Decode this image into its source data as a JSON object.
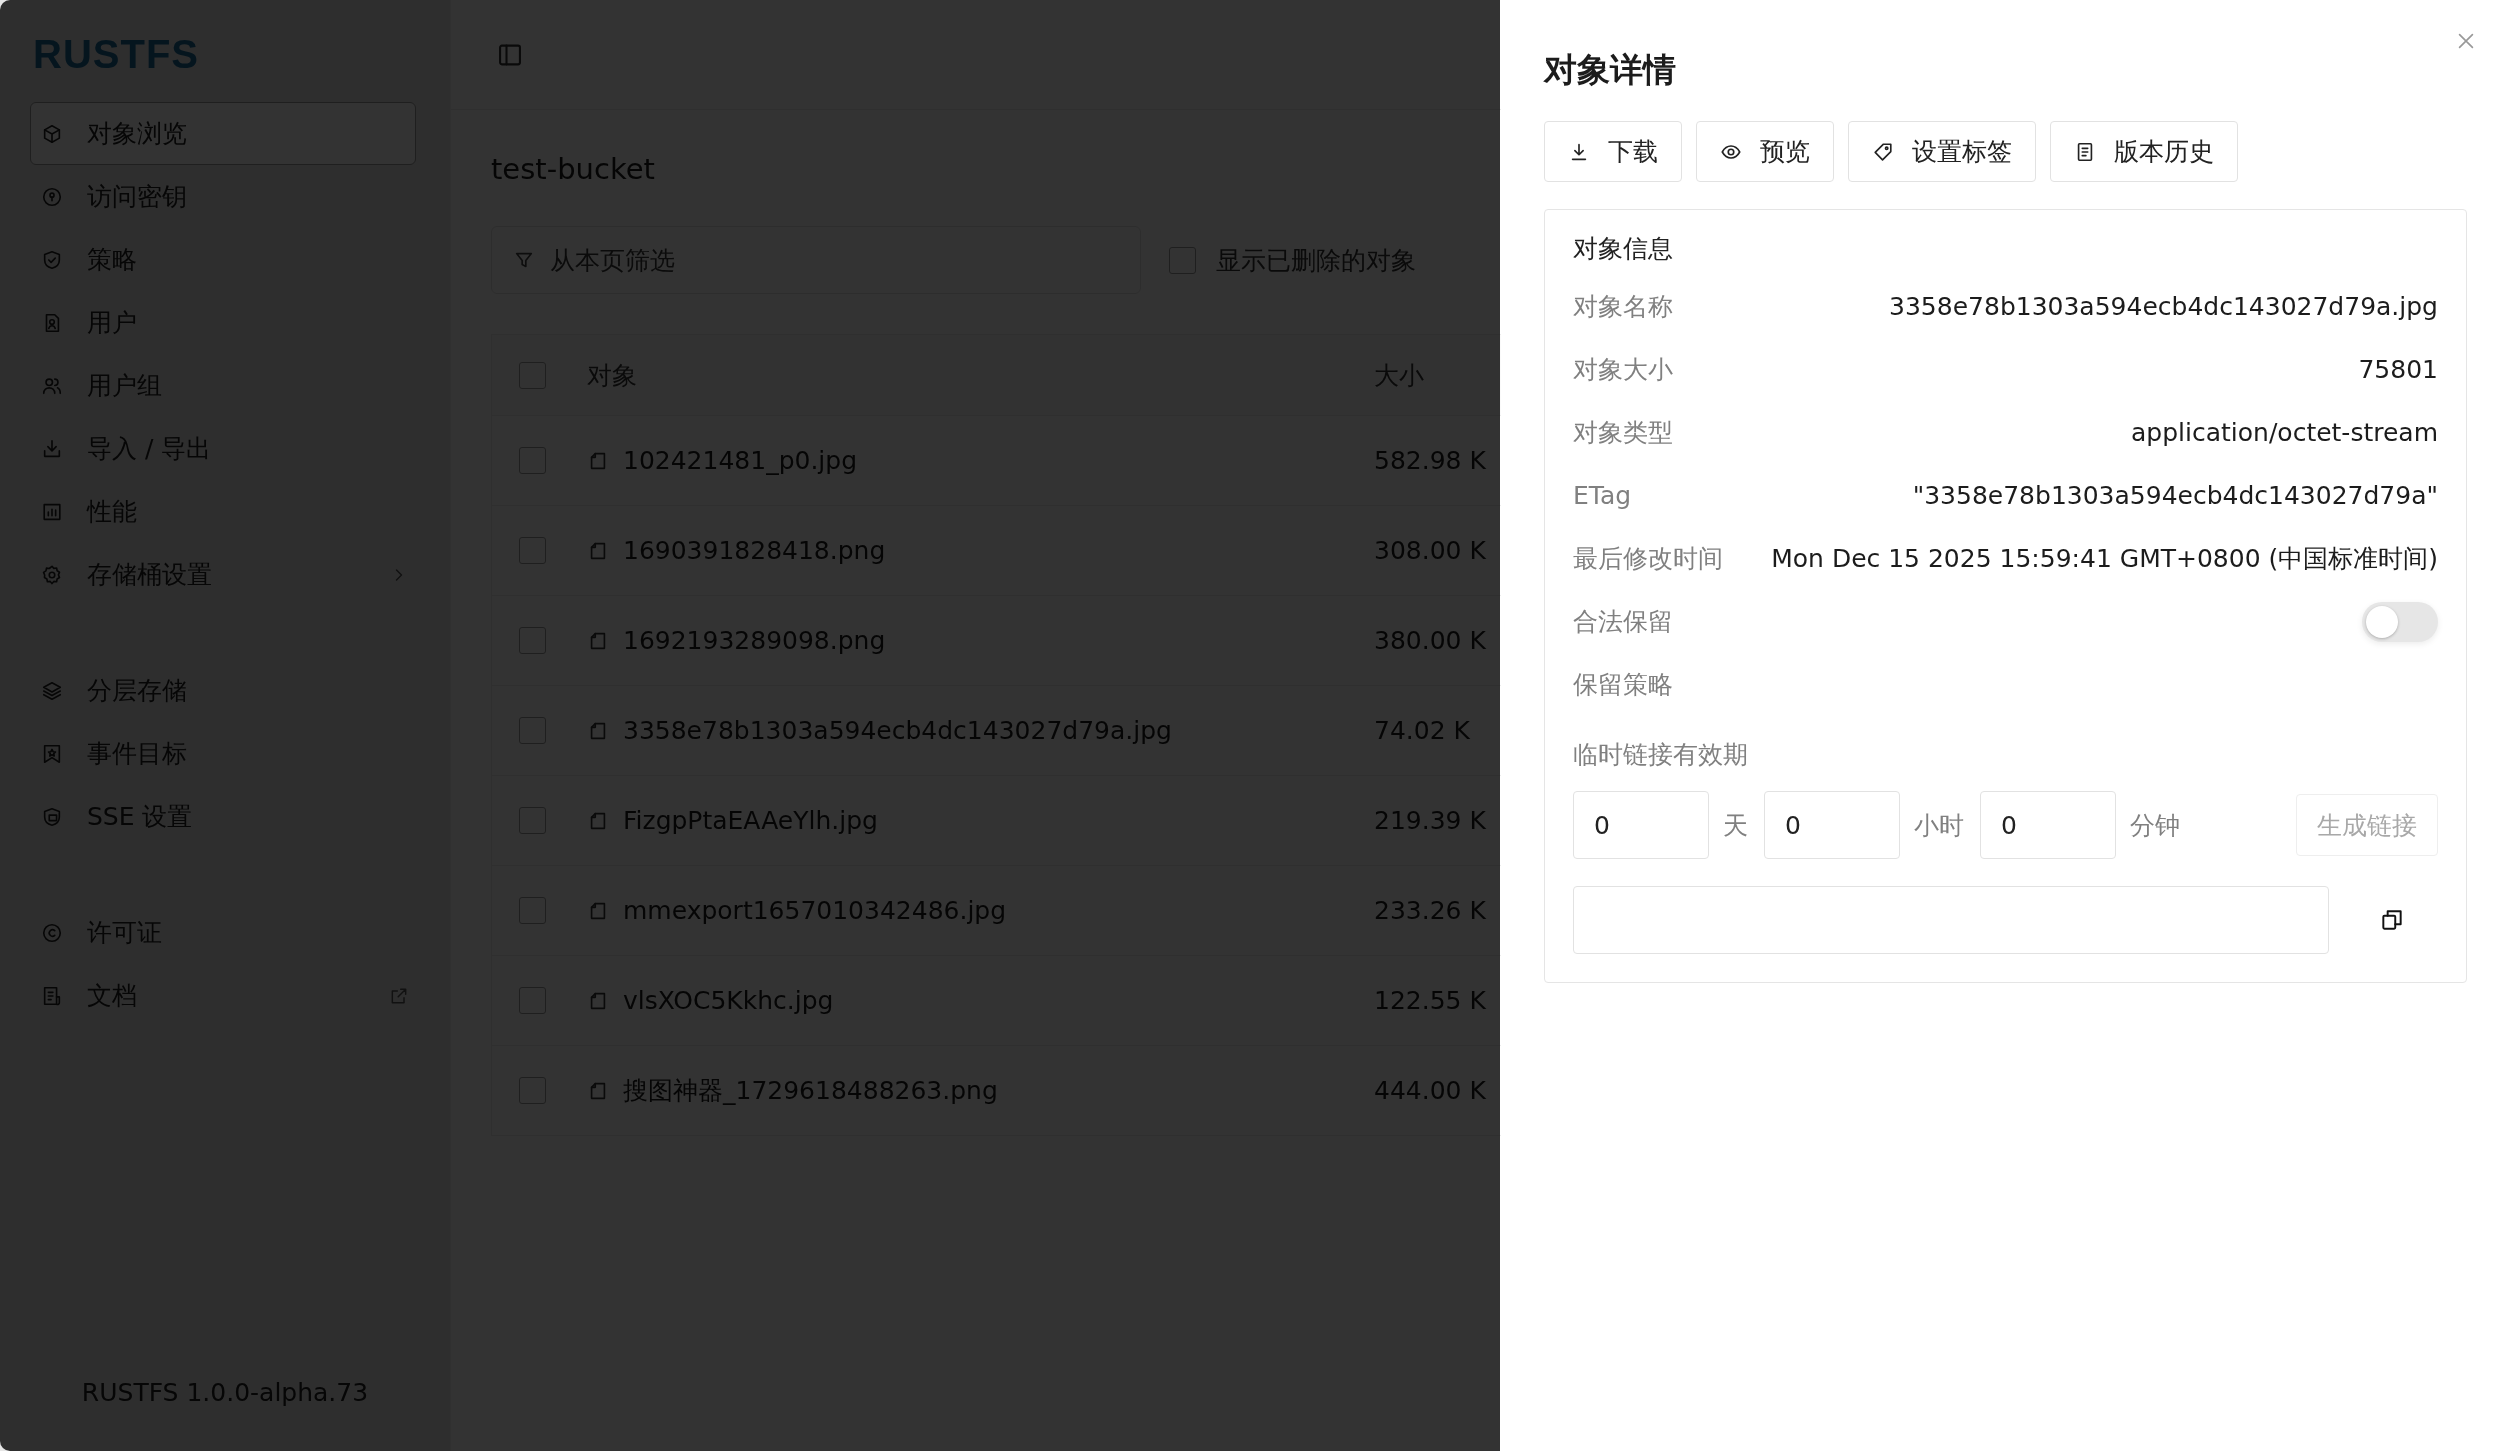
{
  "sidebar": {
    "logo": "RUSTFS",
    "groups": [
      [
        {
          "label": "对象浏览",
          "kind": "link",
          "selected": true
        },
        {
          "label": "访问密钥",
          "kind": "link",
          "selected": false
        },
        {
          "label": "策略",
          "kind": "link",
          "selected": false
        },
        {
          "label": "用户",
          "kind": "link",
          "selected": false
        },
        {
          "label": "用户组",
          "kind": "link",
          "selected": false
        },
        {
          "label": "导入 / 导出",
          "kind": "link",
          "selected": false
        },
        {
          "label": "性能",
          "kind": "link",
          "selected": false
        },
        {
          "label": "存储桶设置",
          "kind": "submenu",
          "selected": false
        }
      ],
      [
        {
          "label": "分层存储",
          "kind": "link",
          "selected": false
        },
        {
          "label": "事件目标",
          "kind": "link",
          "selected": false
        },
        {
          "label": "SSE 设置",
          "kind": "link",
          "selected": false
        }
      ],
      [
        {
          "label": "许可证",
          "kind": "link",
          "selected": false
        },
        {
          "label": "文档",
          "kind": "external",
          "selected": false
        }
      ]
    ],
    "version": "RUSTFS 1.0.0-alpha.73"
  },
  "main": {
    "title": "test-bucket",
    "filter": {
      "placeholder": "从本页筛选"
    },
    "show_deleted": {
      "label": "显示已删除的对象",
      "checked": false
    },
    "table": {
      "columns": [
        "对象",
        "大小"
      ],
      "select_all_checked": false,
      "rows": [
        {
          "name": "102421481_p0.jpg",
          "size": "582.98 K",
          "checked": false
        },
        {
          "name": "1690391828418.png",
          "size": "308.00 K",
          "checked": false
        },
        {
          "name": "1692193289098.png",
          "size": "380.00 K",
          "checked": false
        },
        {
          "name": "3358e78b1303a594ecb4dc143027d79a.jpg",
          "size": "74.02 K",
          "checked": false
        },
        {
          "name": "FizgpPtaEAAeYlh.jpg",
          "size": "219.39 K",
          "checked": false
        },
        {
          "name": "mmexport1657010342486.jpg",
          "size": "233.26 K",
          "checked": false
        },
        {
          "name": "vlsXOC5Kkhc.jpg",
          "size": "122.55 K",
          "checked": false
        },
        {
          "name": "搜图神器_1729618488263.png",
          "size": "444.00 K",
          "checked": false
        }
      ]
    }
  },
  "drawer": {
    "title": "对象详情",
    "actions": [
      "下载",
      "预览",
      "设置标签",
      "版本历史"
    ],
    "info": {
      "heading": "对象信息",
      "fields": [
        {
          "label": "对象名称",
          "value": "3358e78b1303a594ecb4dc143027d79a.jpg"
        },
        {
          "label": "对象大小",
          "value": "75801"
        },
        {
          "label": "对象类型",
          "value": "application/octet-stream"
        },
        {
          "label": "ETag",
          "value": "\"3358e78b1303a594ecb4dc143027d79a\""
        },
        {
          "label": "最后修改时间",
          "value": "Mon Dec 15 2025 15:59:41 GMT+0800 (中国标准时间)"
        }
      ],
      "legal_hold": {
        "label": "合法保留",
        "on": false
      },
      "retention": {
        "label": "保留策略"
      },
      "temp_link": {
        "label": "临时链接有效期",
        "fields": [
          {
            "value": "0",
            "unit": "天"
          },
          {
            "value": "0",
            "unit": "小时"
          },
          {
            "value": "0",
            "unit": "分钟"
          }
        ],
        "generate_button": {
          "label": "生成链接",
          "disabled": true
        }
      }
    }
  }
}
